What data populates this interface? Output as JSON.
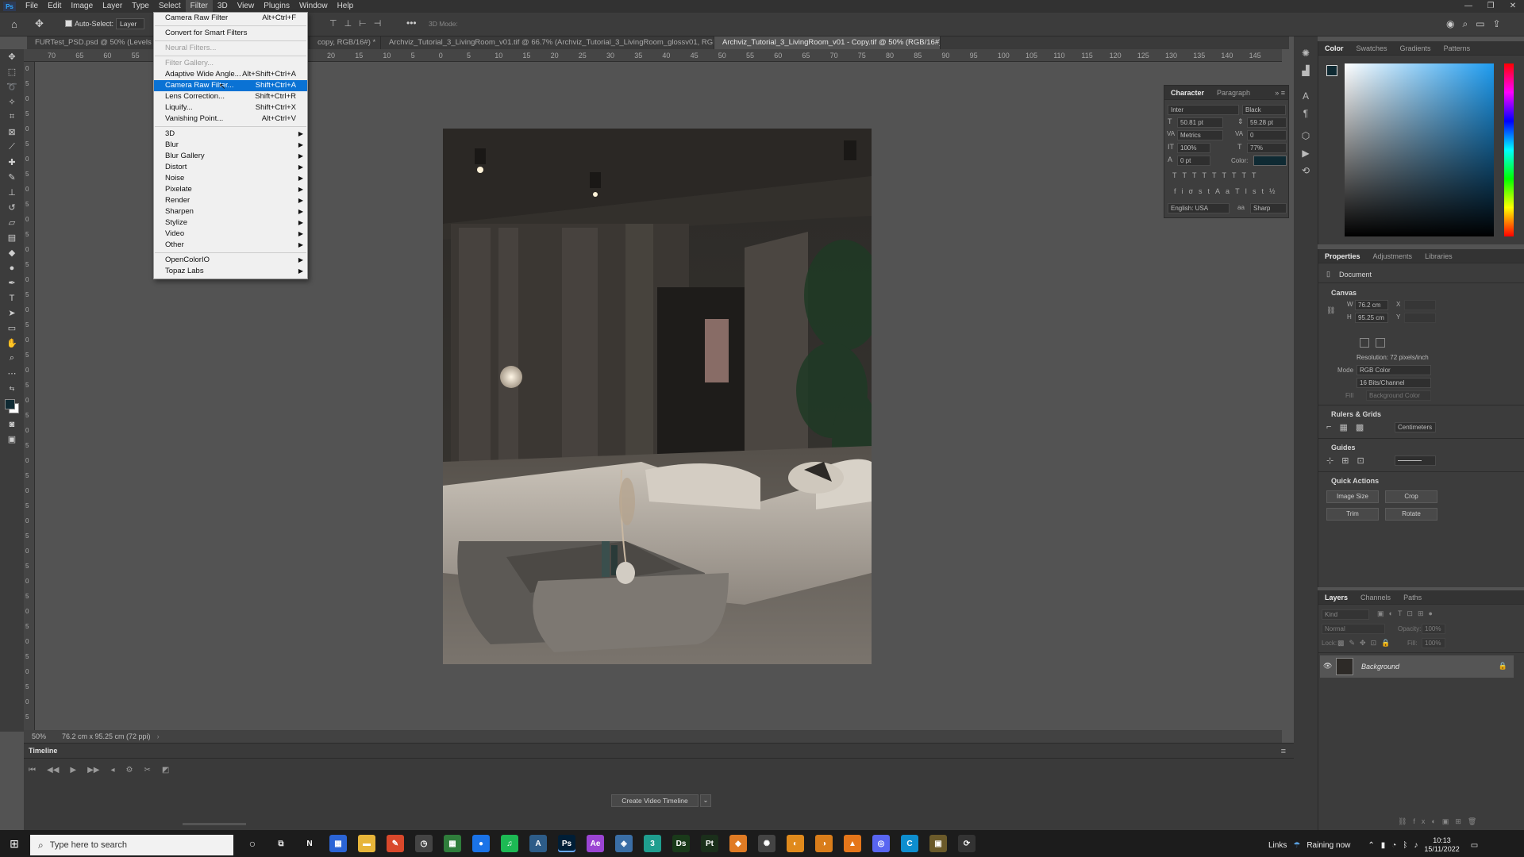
{
  "app": {
    "logo": "Ps"
  },
  "menubar": [
    "File",
    "Edit",
    "Image",
    "Layer",
    "Type",
    "Select",
    "Filter",
    "3D",
    "View",
    "Plugins",
    "Window",
    "Help"
  ],
  "window_controls": [
    "—",
    "❐",
    "✕"
  ],
  "options": {
    "auto_select": "Auto-Select:",
    "layer": "Layer",
    "mode_3d": "3D Mode:"
  },
  "tabs": [
    {
      "label": "FURTest_PSD.psd @ 50% (Levels 4, Layer...",
      "close": "×"
    },
    {
      "label": "copy, RGB/16#) *",
      "close": "×"
    },
    {
      "label": "Archviz_Tutorial_3_LivingRoom_v01.tif @ 66.7% (Archviz_Tutorial_3_LivingRoom_glossv01, RGB/16#) *",
      "close": "×"
    },
    {
      "label": "Archviz_Tutorial_3_LivingRoom_v01 - Copy.tif @ 50% (RGB/16#) *",
      "close": "×"
    }
  ],
  "ruler_ticks": [
    "70",
    "65",
    "60",
    "55",
    "50",
    "45",
    "40",
    "35",
    "30",
    "25",
    "20",
    "15",
    "10",
    "5",
    "0",
    "5",
    "10",
    "15",
    "20",
    "25",
    "30",
    "35",
    "40",
    "45",
    "50",
    "55",
    "60",
    "65",
    "70",
    "75",
    "80",
    "85",
    "90",
    "95",
    "100",
    "105",
    "110",
    "115",
    "120",
    "125",
    "130",
    "135",
    "140",
    "145"
  ],
  "ruler_v_ticks": [
    "0",
    "5",
    "0",
    "5",
    "0",
    "5",
    "0",
    "5",
    "0",
    "5",
    "0",
    "5",
    "0",
    "5",
    "0",
    "5",
    "0",
    "5",
    "0",
    "5",
    "0",
    "5",
    "0",
    "5",
    "0",
    "5",
    "0",
    "5",
    "0",
    "5",
    "0",
    "5",
    "0",
    "5",
    "0",
    "5",
    "0",
    "5",
    "0",
    "5",
    "0",
    "5",
    "0",
    "5"
  ],
  "filter_menu": {
    "items": [
      {
        "label": "Camera Raw Filter",
        "shortcut": "Alt+Ctrl+F"
      },
      {
        "sep": true
      },
      {
        "label": "Convert for Smart Filters"
      },
      {
        "sep": true
      },
      {
        "label": "Neural Filters...",
        "disabled": true
      },
      {
        "sep": true
      },
      {
        "label": "Filter Gallery...",
        "disabled": true
      },
      {
        "label": "Adaptive Wide Angle...",
        "shortcut": "Alt+Shift+Ctrl+A"
      },
      {
        "label": "Camera Raw Filter...",
        "shortcut": "Shift+Ctrl+A",
        "highlighted": true
      },
      {
        "label": "Lens Correction...",
        "shortcut": "Shift+Ctrl+R"
      },
      {
        "label": "Liquify...",
        "shortcut": "Shift+Ctrl+X"
      },
      {
        "label": "Vanishing Point...",
        "shortcut": "Alt+Ctrl+V"
      },
      {
        "sep": true
      },
      {
        "label": "3D",
        "submenu": true
      },
      {
        "label": "Blur",
        "submenu": true
      },
      {
        "label": "Blur Gallery",
        "submenu": true
      },
      {
        "label": "Distort",
        "submenu": true
      },
      {
        "label": "Noise",
        "submenu": true
      },
      {
        "label": "Pixelate",
        "submenu": true
      },
      {
        "label": "Render",
        "submenu": true
      },
      {
        "label": "Sharpen",
        "submenu": true
      },
      {
        "label": "Stylize",
        "submenu": true
      },
      {
        "label": "Video",
        "submenu": true
      },
      {
        "label": "Other",
        "submenu": true
      },
      {
        "sep": true
      },
      {
        "label": "OpenColorIO",
        "submenu": true
      },
      {
        "label": "Topaz Labs",
        "submenu": true
      }
    ],
    "arrow": "▶"
  },
  "character": {
    "tabs": [
      "Character",
      "Paragraph"
    ],
    "font": "Inter",
    "style": "Black",
    "size": "50.81 pt",
    "leading": "59.28 pt",
    "kerning": "Metrics",
    "tracking": "0",
    "vscale": "100%",
    "hscale": "77%",
    "baseline": "0 pt",
    "color_label": "Color:",
    "language": "English: USA",
    "aa": "Sharp",
    "color": "#0f2a33"
  },
  "color_panel": {
    "tabs": [
      "Color",
      "Swatches",
      "Gradients",
      "Patterns"
    ]
  },
  "properties": {
    "tabs": [
      "Properties",
      "Adjustments",
      "Libraries"
    ],
    "doc": "Document",
    "canvas": "Canvas",
    "w_label": "W",
    "w": "76.2 cm",
    "h_label": "H",
    "h": "95.25 cm",
    "x_label": "X",
    "y_label": "Y",
    "resolution": "Resolution: 72 pixels/inch",
    "mode_label": "Mode",
    "mode": "RGB Color",
    "bits": "16 Bits/Channel",
    "fill_label": "Fill",
    "fill": "Background Color",
    "rulers": "Rulers & Grids",
    "units": "Centimeters",
    "guides": "Guides",
    "quick": "Quick Actions",
    "qa": [
      "Image Size",
      "Crop",
      "Trim",
      "Rotate"
    ]
  },
  "layers": {
    "tabs": [
      "Layers",
      "Channels",
      "Paths"
    ],
    "kind": "Kind",
    "blend": "Normal",
    "opacity_label": "Opacity:",
    "opacity": "100%",
    "lock_label": "Lock:",
    "fill_label": "Fill:",
    "fill": "100%",
    "layer": "Background"
  },
  "status": {
    "zoom": "50%",
    "info": "76.2 cm x 95.25 cm (72 ppi)"
  },
  "timeline": {
    "title": "Timeline",
    "create": "Create Video Timeline"
  },
  "taskbar": {
    "search": "Type here to search",
    "links": "Links",
    "weather": "Raining now",
    "time": "10:13",
    "date": "15/11/2022",
    "apps": [
      {
        "label": "N",
        "color": "#1c1c1c"
      },
      {
        "label": "▦",
        "color": "#2b64d6"
      },
      {
        "label": "▬",
        "color": "#e7b53a"
      },
      {
        "label": "✎",
        "color": "#d9482b"
      },
      {
        "label": "◷",
        "color": "#444"
      },
      {
        "label": "▦",
        "color": "#2f7d3b"
      },
      {
        "label": "●",
        "color": "#1a73e8"
      },
      {
        "label": "♫",
        "color": "#1db954"
      },
      {
        "label": "A",
        "color": "#2d5c88"
      },
      {
        "label": "Ps",
        "color": "#001e36"
      },
      {
        "label": "Ae",
        "color": "#9b44d3"
      },
      {
        "label": "◈",
        "color": "#3a6ea5"
      },
      {
        "label": "3",
        "color": "#1f9e8f"
      },
      {
        "label": "Ds",
        "color": "#1a3a1a"
      },
      {
        "label": "Pt",
        "color": "#1b2f1b"
      },
      {
        "label": "◆",
        "color": "#e07b24"
      },
      {
        "label": "✺",
        "color": "#444"
      },
      {
        "label": "◐",
        "color": "#e08a1c"
      },
      {
        "label": "◑",
        "color": "#d97d1a"
      },
      {
        "label": "▲",
        "color": "#e5761a"
      },
      {
        "label": "◎",
        "color": "#5865f2"
      },
      {
        "label": "C",
        "color": "#0e8ecf"
      },
      {
        "label": "▣",
        "color": "#6b5a2a"
      },
      {
        "label": "⟳",
        "color": "#333"
      }
    ]
  }
}
